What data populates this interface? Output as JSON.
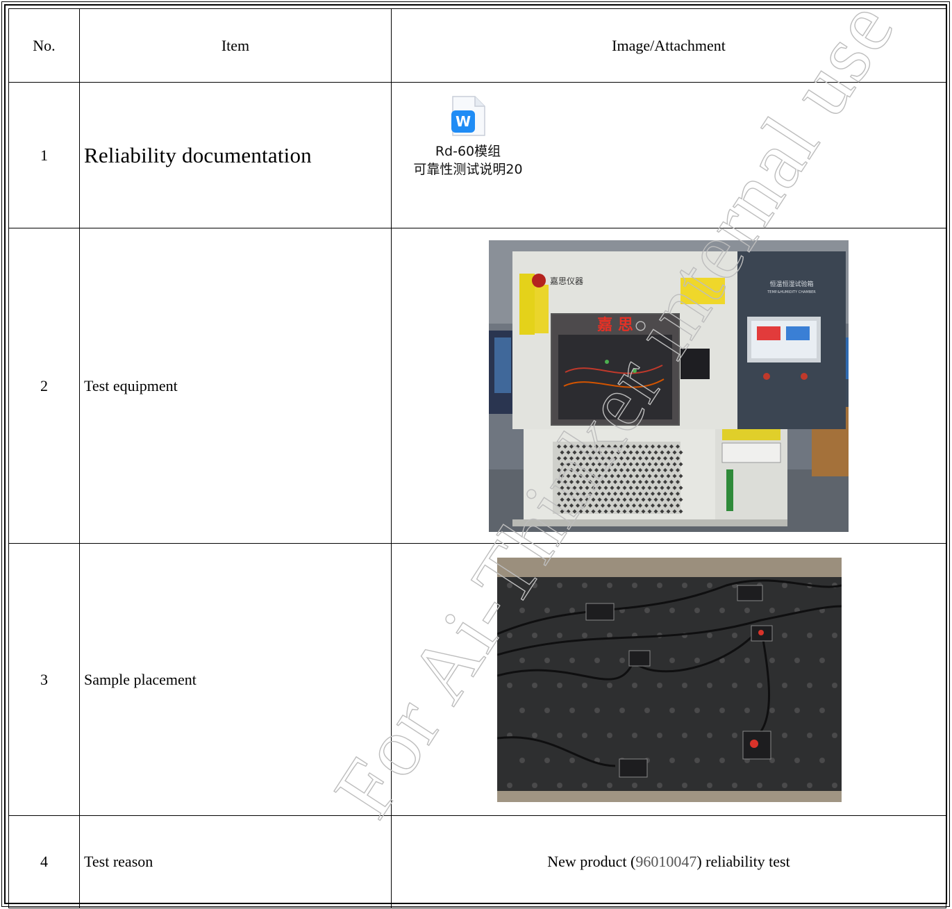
{
  "table": {
    "headers": {
      "no": "No.",
      "item": "Item",
      "attachment": "Image/Attachment"
    },
    "rows": [
      {
        "no": "1",
        "item": "Reliability documentation",
        "file_name_line1": "Rd-60模组",
        "file_name_line2": "可靠性测试说明20",
        "file_icon": "word-document-icon",
        "icon_letter": "W"
      },
      {
        "no": "2",
        "item": "Test equipment",
        "photo_sign_text": "嘉 思",
        "photo_brand": "嘉思仪器",
        "photo_panel_title": "恒温恒湿试验箱",
        "photo_panel_subtitle": "TEMP.&HUMIDITY CHAMBER"
      },
      {
        "no": "3",
        "item": "Sample placement"
      },
      {
        "no": "4",
        "item": "Test reason",
        "reason_prefix": "New product (",
        "reason_part_number": "96010047",
        "reason_suffix": ") reliability test"
      }
    ]
  },
  "watermark": {
    "text": "For Ai-Thinker internal use",
    "color": "#c9c9c9"
  }
}
